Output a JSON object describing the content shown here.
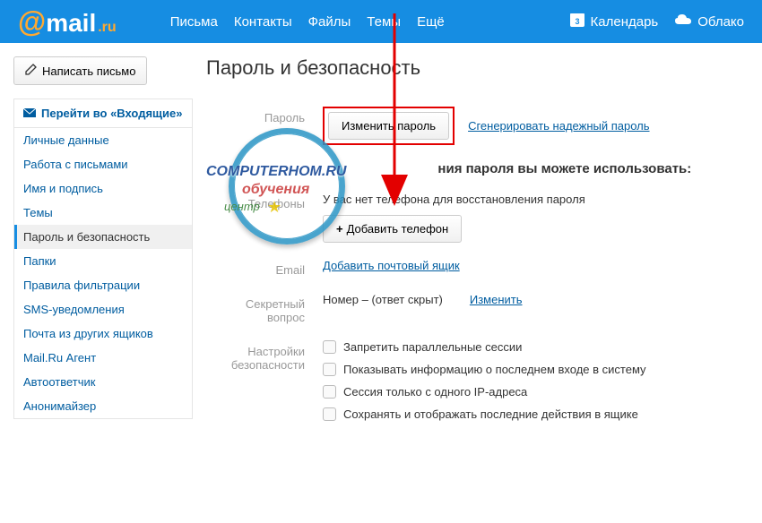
{
  "header": {
    "logo": {
      "at": "@",
      "mail": "mail",
      "dot_ru": ".ru"
    },
    "nav": [
      "Письма",
      "Контакты",
      "Файлы",
      "Темы",
      "Ещё"
    ],
    "nav_right": {
      "calendar": "Календарь",
      "cloud": "Облако",
      "cal_day": "3"
    }
  },
  "compose": "Написать письмо",
  "sidebar": {
    "inbox": "Перейти во «Входящие»",
    "items": [
      "Личные данные",
      "Работа с письмами",
      "Имя и подпись",
      "Темы",
      "Пароль и безопасность",
      "Папки",
      "Правила фильтрации",
      "SMS-уведомления",
      "Почта из других ящиков",
      "Mail.Ru Агент",
      "Автоответчик",
      "Анонимайзер"
    ],
    "active_index": 4
  },
  "page": {
    "title": "Пароль и безопасность",
    "labels": {
      "password": "Пароль",
      "phones": "Телефоны",
      "email": "Email",
      "secret": "Секретный вопрос",
      "security": "Настройки безопасности"
    },
    "change_password": "Изменить пароль",
    "generate_password": "Сгенерировать надежный пароль",
    "restore_heading_suffix": "ния пароля вы можете использовать:",
    "no_phone": "У вас нет телефона для восстановления пароля",
    "add_phone": "Добавить телефон",
    "add_email": "Добавить почтовый ящик",
    "secret_value": "Номер – (ответ скрыт)",
    "change": "Изменить",
    "checkboxes": [
      "Запретить параллельные сессии",
      "Показывать информацию о последнем входе в систему",
      "Сессия только с одного IP-адреса",
      "Сохранять и отображать последние действия в ящике"
    ]
  },
  "watermark": {
    "line1": "COMPUTERHOM.RU",
    "line2": "обучения",
    "line3": "центр"
  }
}
